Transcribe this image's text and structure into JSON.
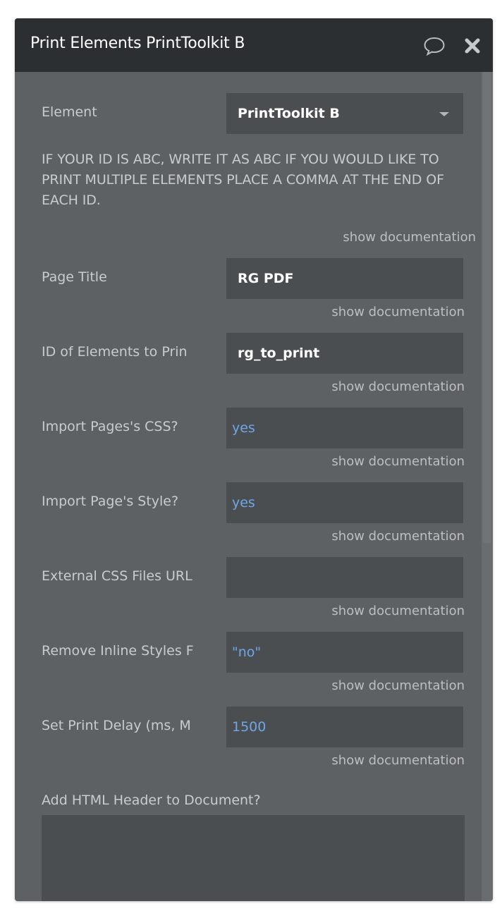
{
  "header": {
    "title": "Print Elements PrintToolkit B",
    "comment_icon": "comment-bubble-icon",
    "close_icon": "close-icon"
  },
  "element_select": {
    "label": "Element",
    "value": "PrintToolkit B"
  },
  "notice": "IF YOUR ID IS ABC, WRITE IT AS ABC IF YOU WOULD LIKE TO PRINT MULTIPLE ELEMENTS PLACE A COMMA AT THE END OF EACH ID.",
  "doc_link_label": "show documentation",
  "fields": [
    {
      "label": "Page Title",
      "value": "RG PDF",
      "style": "bold"
    },
    {
      "label": "ID of Elements to Prin",
      "value": "rg_to_print",
      "style": "bold"
    },
    {
      "label": "Import Pages's CSS?",
      "value": "yes",
      "style": "blue"
    },
    {
      "label": "Import Page's Style?",
      "value": "yes",
      "style": "blue"
    },
    {
      "label": "External CSS Files URL",
      "value": "",
      "style": "bold"
    },
    {
      "label": "Remove Inline Styles F",
      "value": "\"no\"",
      "style": "blue"
    },
    {
      "label": "Set Print Delay (ms, M",
      "value": "1500",
      "style": "blue"
    }
  ],
  "html_header": {
    "label": "Add HTML Header to Document?",
    "value": ""
  },
  "colors": {
    "panel_bg": "#5e6164",
    "header_bg": "#2c2f31",
    "field_bg": "#4b4e51",
    "dynamic_value": "#6fa6e6"
  }
}
